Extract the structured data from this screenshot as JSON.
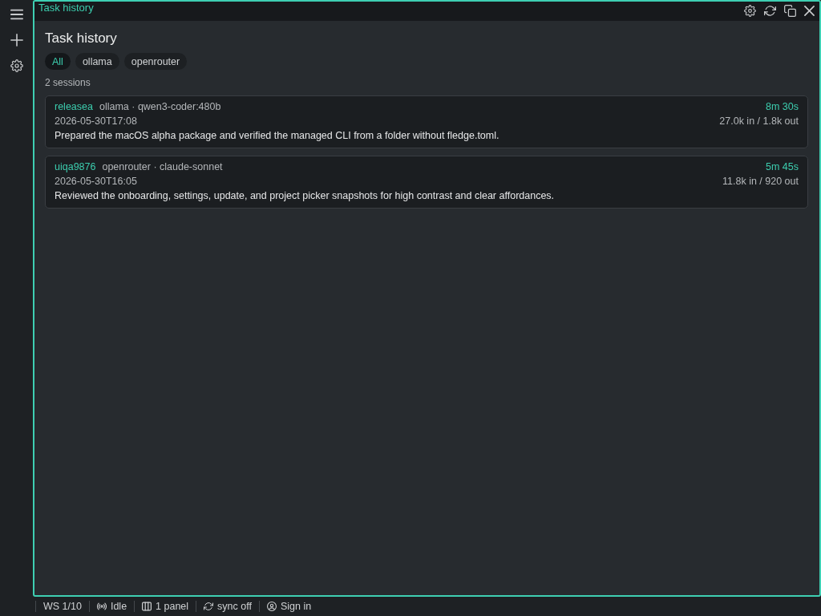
{
  "panel": {
    "title": "Task history",
    "heading": "Task history",
    "filters": [
      {
        "label": "All",
        "selected": true
      },
      {
        "label": "ollama",
        "selected": false
      },
      {
        "label": "openrouter",
        "selected": false
      }
    ],
    "count": "2 sessions",
    "sessions": [
      {
        "name": "releasea",
        "model": "ollama · qwen3-coder:480b",
        "duration": "8m 30s",
        "timestamp": "2026-05-30T17:08",
        "tokens": "27.0k in / 1.8k out",
        "summary": "Prepared the macOS alpha package and verified the managed CLI from a folder without fledge.toml."
      },
      {
        "name": "uiqa9876",
        "model": "openrouter · claude-sonnet",
        "duration": "5m 45s",
        "timestamp": "2026-05-30T16:05",
        "tokens": "11.8k in / 920 out",
        "summary": "Reviewed the onboarding, settings, update, and project picker snapshots for high contrast and clear affordances."
      }
    ]
  },
  "status_bar": {
    "items": [
      {
        "kind": "workspace",
        "label": "WS 1/10"
      },
      {
        "kind": "activity",
        "label": "Idle"
      },
      {
        "kind": "panels",
        "label": "1 panel"
      },
      {
        "kind": "sync",
        "label": "sync off"
      },
      {
        "kind": "account",
        "label": "Sign in"
      }
    ]
  }
}
